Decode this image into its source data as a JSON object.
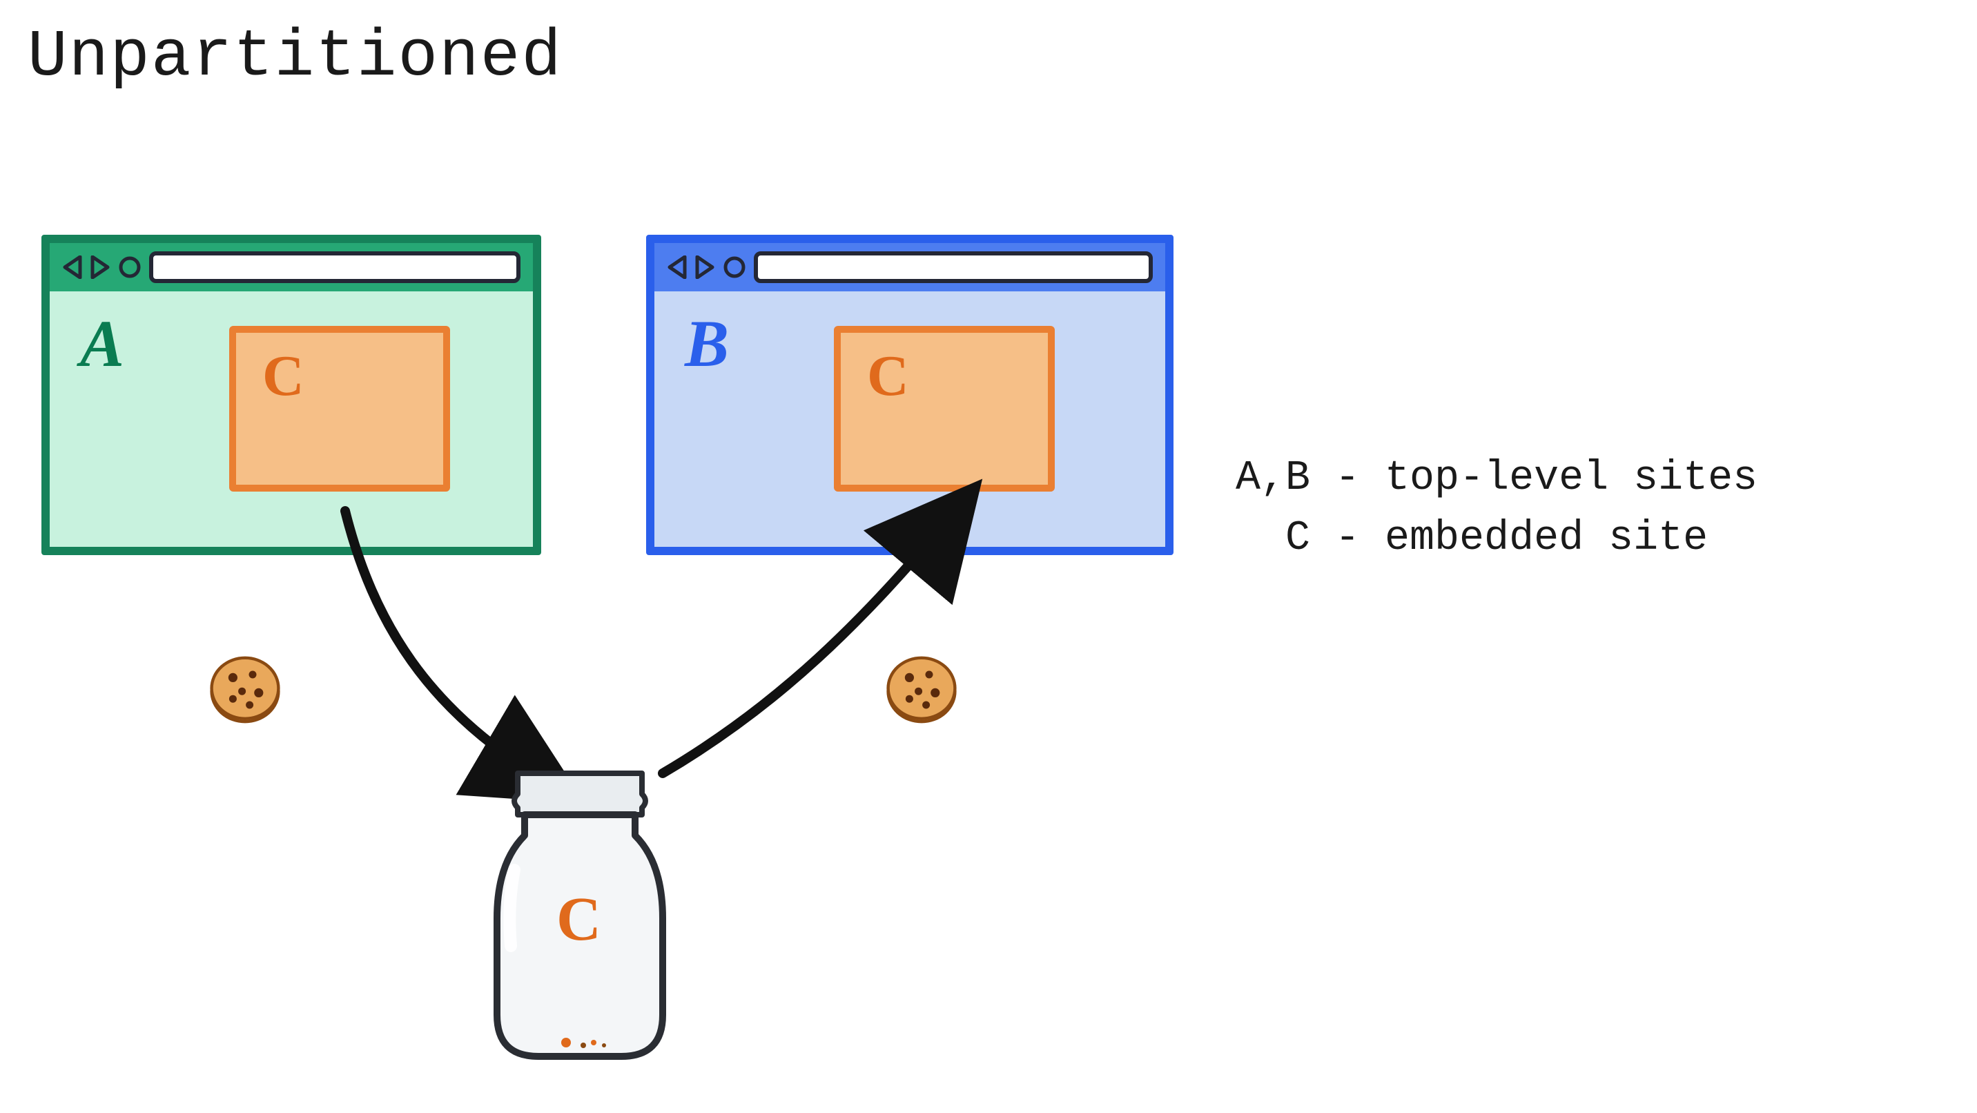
{
  "title": "Unpartitioned",
  "browsers": {
    "a": {
      "site_label": "A",
      "embed_label": "C"
    },
    "b": {
      "site_label": "B",
      "embed_label": "C"
    }
  },
  "cookies": {
    "left": "cookie",
    "right": "cookie"
  },
  "jar": {
    "label": "C"
  },
  "legend": {
    "line1": "A,B - top-level sites",
    "line2": "  C - embedded site"
  },
  "colors": {
    "browser_a_border": "#16825a",
    "browser_a_fill": "#c8f2de",
    "browser_a_label": "#0a7c51",
    "browser_b_border": "#2a5feb",
    "browser_b_fill": "#c7d8f6",
    "browser_b_label": "#2a5feb",
    "embed_border": "#ea7f32",
    "embed_fill": "#f6bf87",
    "embed_label": "#e06a1c",
    "arrow": "#111111"
  }
}
